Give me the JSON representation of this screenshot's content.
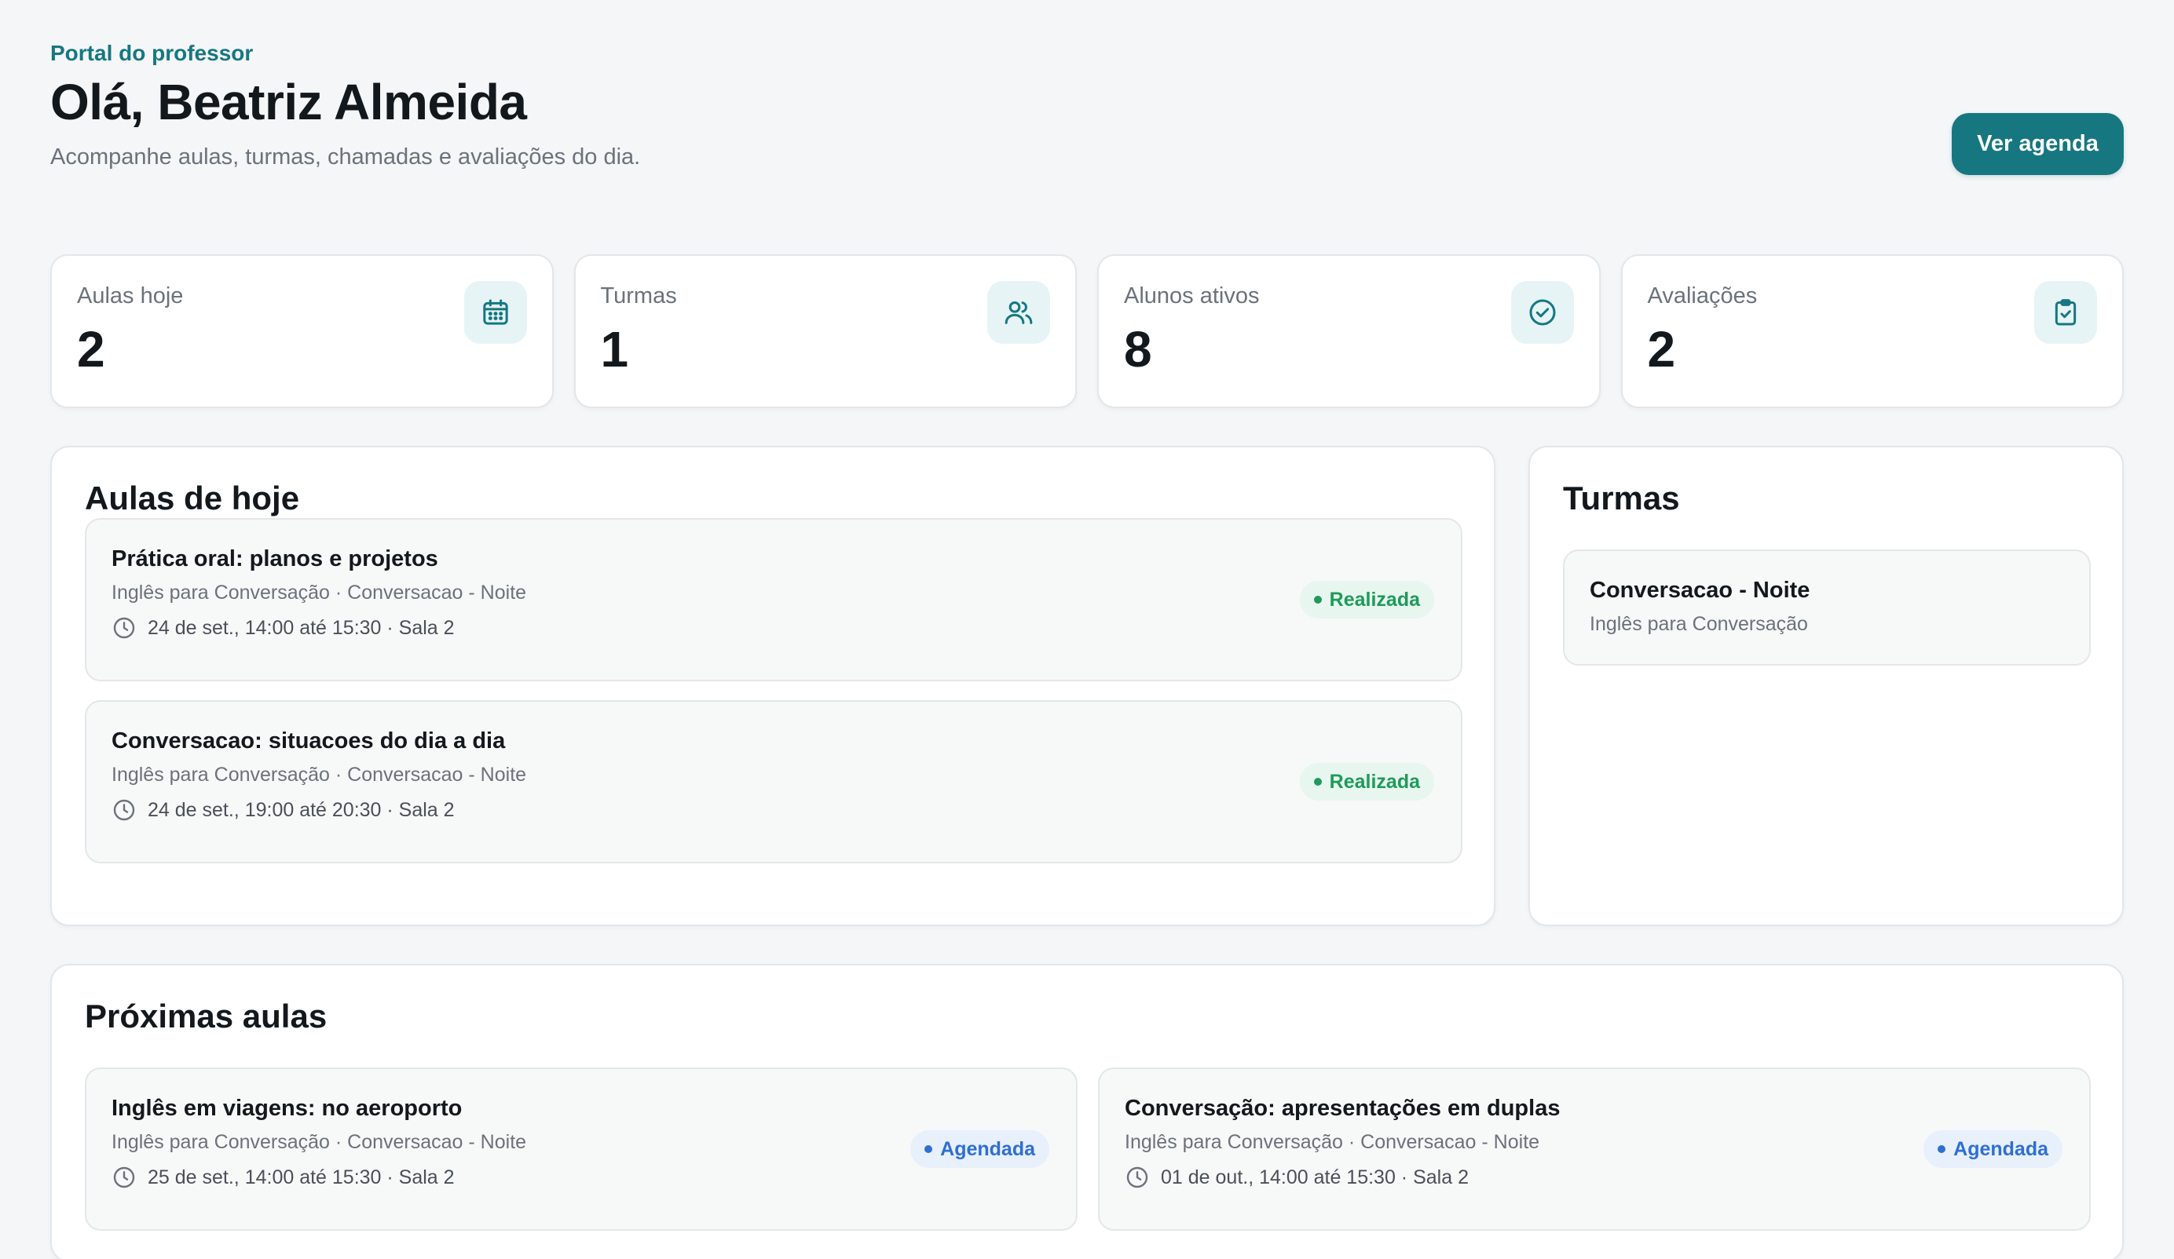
{
  "header": {
    "eyebrow": "Portal do professor",
    "title": "Olá, Beatriz Almeida",
    "subtitle": "Acompanhe aulas, turmas, chamadas e avaliações do dia.",
    "action_label": "Ver agenda"
  },
  "stats": [
    {
      "label": "Aulas hoje",
      "value": "2",
      "icon": "calendar-icon"
    },
    {
      "label": "Turmas",
      "value": "1",
      "icon": "users-icon"
    },
    {
      "label": "Alunos ativos",
      "value": "8",
      "icon": "check-circle-icon"
    },
    {
      "label": "Avaliações",
      "value": "2",
      "icon": "clipboard-check-icon"
    }
  ],
  "today": {
    "title": "Aulas de hoje",
    "lessons": [
      {
        "title": "Prática oral: planos e projetos",
        "subtitle": "Inglês para Conversação · Conversacao - Noite",
        "time": "24 de set., 14:00 até 15:30 · Sala 2",
        "status": "Realizada"
      },
      {
        "title": "Conversacao: situacoes do dia a dia",
        "subtitle": "Inglês para Conversação · Conversacao - Noite",
        "time": "24 de set., 19:00 até 20:30 · Sala 2",
        "status": "Realizada"
      }
    ]
  },
  "classes": {
    "title": "Turmas",
    "items": [
      {
        "name": "Conversacao - Noite",
        "course": "Inglês para Conversação"
      }
    ]
  },
  "upcoming": {
    "title": "Próximas aulas",
    "lessons": [
      {
        "title": "Inglês em viagens: no aeroporto",
        "subtitle": "Inglês para Conversação · Conversacao - Noite",
        "time": "25 de set., 14:00 até 15:30 · Sala 2",
        "status": "Agendada"
      },
      {
        "title": "Conversação: apresentações em duplas",
        "subtitle": "Inglês para Conversação · Conversacao - Noite",
        "time": "01 de out., 14:00 até 15:30 · Sala 2",
        "status": "Agendada"
      }
    ]
  },
  "colors": {
    "accent": "#167781",
    "done": "#1f9a5b",
    "scheduled": "#2e6fd3"
  }
}
